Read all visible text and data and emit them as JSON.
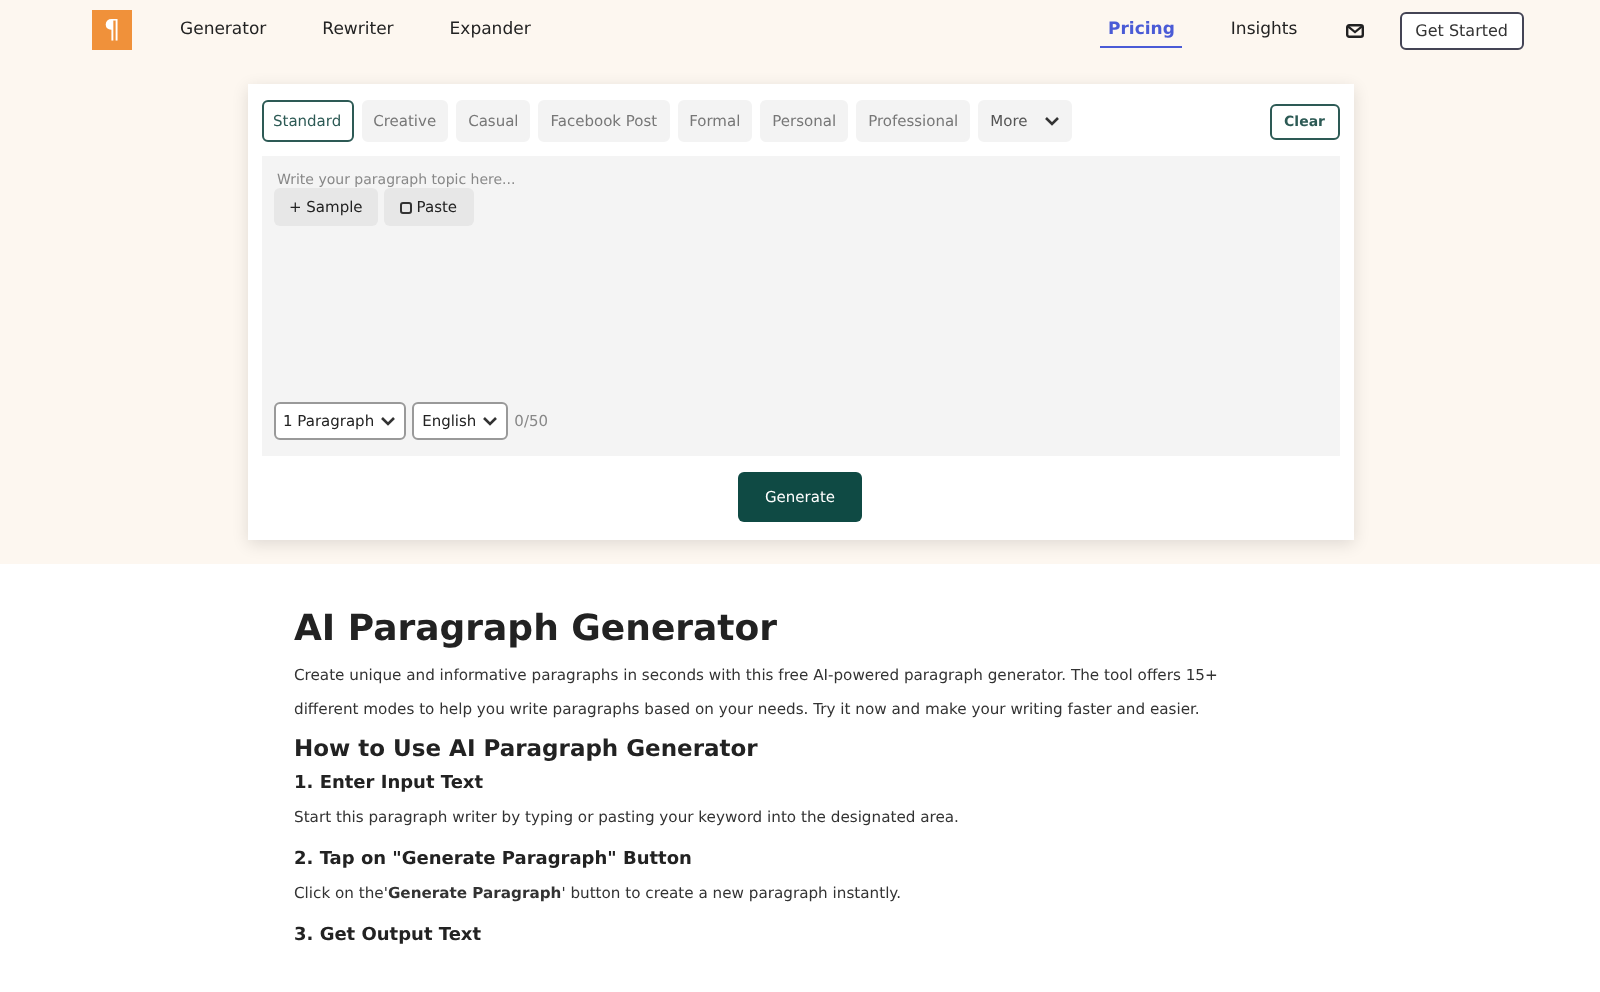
{
  "nav": {
    "logo": "¶",
    "links": [
      {
        "label": "Generator",
        "selected": false
      },
      {
        "label": "Rewriter",
        "selected": false
      },
      {
        "label": "Expander",
        "selected": false
      }
    ],
    "right_links": [
      {
        "label": "Pricing",
        "selected": true
      },
      {
        "label": "Insights",
        "selected": false
      }
    ],
    "cta": "Get Started"
  },
  "tool": {
    "modes": [
      {
        "label": "Standard",
        "selected": true
      },
      {
        "label": "Creative",
        "selected": false
      },
      {
        "label": "Casual",
        "selected": false
      },
      {
        "label": "Facebook Post",
        "selected": false
      },
      {
        "label": "Formal",
        "selected": false
      },
      {
        "label": "Personal",
        "selected": false
      },
      {
        "label": "Professional",
        "selected": false
      }
    ],
    "more": "More",
    "clear": "Clear",
    "placeholder": "Write your paragraph topic here...",
    "sample": "+ Sample",
    "paste": "Paste",
    "length": "1 Paragraph",
    "language": "English",
    "counter": "0/50",
    "generate": "Generate"
  },
  "article": {
    "title": "AI Paragraph Generator",
    "intro": "Create unique and informative paragraphs in seconds with this free AI-powered paragraph generator. The tool offers 15+ different modes to help you write paragraphs based on your needs. Try it now and make your writing faster and easier.",
    "how_to": "How to Use AI Paragraph Generator",
    "steps": [
      {
        "heading": "1. Enter Input Text",
        "text": "Start this paragraph writer by typing or pasting your keyword into the designated area."
      },
      {
        "heading": "2. Tap on \"Generate Paragraph\" Button",
        "text": "Click on the'**Generate Paragraph**' button to create a new paragraph instantly."
      },
      {
        "heading": "3. Get Output Text"
      }
    ]
  }
}
